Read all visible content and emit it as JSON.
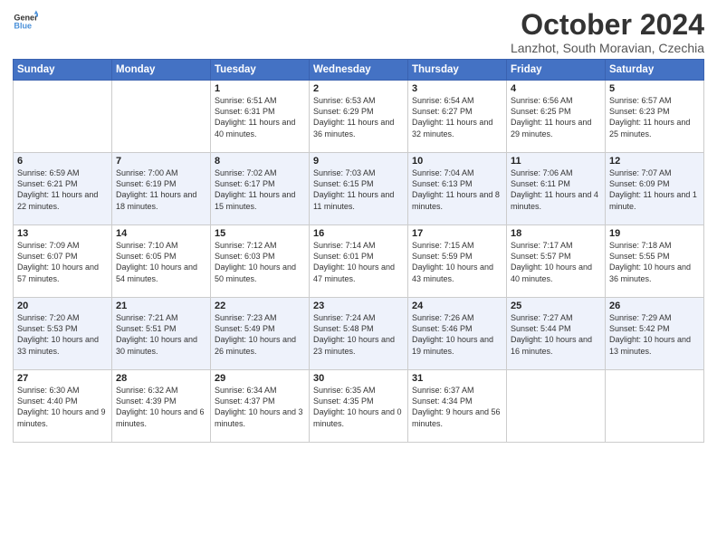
{
  "header": {
    "logo_line1": "General",
    "logo_line2": "Blue",
    "month": "October 2024",
    "location": "Lanzhot, South Moravian, Czechia"
  },
  "days_of_week": [
    "Sunday",
    "Monday",
    "Tuesday",
    "Wednesday",
    "Thursday",
    "Friday",
    "Saturday"
  ],
  "weeks": [
    [
      {
        "num": "",
        "detail": ""
      },
      {
        "num": "",
        "detail": ""
      },
      {
        "num": "1",
        "detail": "Sunrise: 6:51 AM\nSunset: 6:31 PM\nDaylight: 11 hours and 40 minutes."
      },
      {
        "num": "2",
        "detail": "Sunrise: 6:53 AM\nSunset: 6:29 PM\nDaylight: 11 hours and 36 minutes."
      },
      {
        "num": "3",
        "detail": "Sunrise: 6:54 AM\nSunset: 6:27 PM\nDaylight: 11 hours and 32 minutes."
      },
      {
        "num": "4",
        "detail": "Sunrise: 6:56 AM\nSunset: 6:25 PM\nDaylight: 11 hours and 29 minutes."
      },
      {
        "num": "5",
        "detail": "Sunrise: 6:57 AM\nSunset: 6:23 PM\nDaylight: 11 hours and 25 minutes."
      }
    ],
    [
      {
        "num": "6",
        "detail": "Sunrise: 6:59 AM\nSunset: 6:21 PM\nDaylight: 11 hours and 22 minutes."
      },
      {
        "num": "7",
        "detail": "Sunrise: 7:00 AM\nSunset: 6:19 PM\nDaylight: 11 hours and 18 minutes."
      },
      {
        "num": "8",
        "detail": "Sunrise: 7:02 AM\nSunset: 6:17 PM\nDaylight: 11 hours and 15 minutes."
      },
      {
        "num": "9",
        "detail": "Sunrise: 7:03 AM\nSunset: 6:15 PM\nDaylight: 11 hours and 11 minutes."
      },
      {
        "num": "10",
        "detail": "Sunrise: 7:04 AM\nSunset: 6:13 PM\nDaylight: 11 hours and 8 minutes."
      },
      {
        "num": "11",
        "detail": "Sunrise: 7:06 AM\nSunset: 6:11 PM\nDaylight: 11 hours and 4 minutes."
      },
      {
        "num": "12",
        "detail": "Sunrise: 7:07 AM\nSunset: 6:09 PM\nDaylight: 11 hours and 1 minute."
      }
    ],
    [
      {
        "num": "13",
        "detail": "Sunrise: 7:09 AM\nSunset: 6:07 PM\nDaylight: 10 hours and 57 minutes."
      },
      {
        "num": "14",
        "detail": "Sunrise: 7:10 AM\nSunset: 6:05 PM\nDaylight: 10 hours and 54 minutes."
      },
      {
        "num": "15",
        "detail": "Sunrise: 7:12 AM\nSunset: 6:03 PM\nDaylight: 10 hours and 50 minutes."
      },
      {
        "num": "16",
        "detail": "Sunrise: 7:14 AM\nSunset: 6:01 PM\nDaylight: 10 hours and 47 minutes."
      },
      {
        "num": "17",
        "detail": "Sunrise: 7:15 AM\nSunset: 5:59 PM\nDaylight: 10 hours and 43 minutes."
      },
      {
        "num": "18",
        "detail": "Sunrise: 7:17 AM\nSunset: 5:57 PM\nDaylight: 10 hours and 40 minutes."
      },
      {
        "num": "19",
        "detail": "Sunrise: 7:18 AM\nSunset: 5:55 PM\nDaylight: 10 hours and 36 minutes."
      }
    ],
    [
      {
        "num": "20",
        "detail": "Sunrise: 7:20 AM\nSunset: 5:53 PM\nDaylight: 10 hours and 33 minutes."
      },
      {
        "num": "21",
        "detail": "Sunrise: 7:21 AM\nSunset: 5:51 PM\nDaylight: 10 hours and 30 minutes."
      },
      {
        "num": "22",
        "detail": "Sunrise: 7:23 AM\nSunset: 5:49 PM\nDaylight: 10 hours and 26 minutes."
      },
      {
        "num": "23",
        "detail": "Sunrise: 7:24 AM\nSunset: 5:48 PM\nDaylight: 10 hours and 23 minutes."
      },
      {
        "num": "24",
        "detail": "Sunrise: 7:26 AM\nSunset: 5:46 PM\nDaylight: 10 hours and 19 minutes."
      },
      {
        "num": "25",
        "detail": "Sunrise: 7:27 AM\nSunset: 5:44 PM\nDaylight: 10 hours and 16 minutes."
      },
      {
        "num": "26",
        "detail": "Sunrise: 7:29 AM\nSunset: 5:42 PM\nDaylight: 10 hours and 13 minutes."
      }
    ],
    [
      {
        "num": "27",
        "detail": "Sunrise: 6:30 AM\nSunset: 4:40 PM\nDaylight: 10 hours and 9 minutes."
      },
      {
        "num": "28",
        "detail": "Sunrise: 6:32 AM\nSunset: 4:39 PM\nDaylight: 10 hours and 6 minutes."
      },
      {
        "num": "29",
        "detail": "Sunrise: 6:34 AM\nSunset: 4:37 PM\nDaylight: 10 hours and 3 minutes."
      },
      {
        "num": "30",
        "detail": "Sunrise: 6:35 AM\nSunset: 4:35 PM\nDaylight: 10 hours and 0 minutes."
      },
      {
        "num": "31",
        "detail": "Sunrise: 6:37 AM\nSunset: 4:34 PM\nDaylight: 9 hours and 56 minutes."
      },
      {
        "num": "",
        "detail": ""
      },
      {
        "num": "",
        "detail": ""
      }
    ]
  ]
}
